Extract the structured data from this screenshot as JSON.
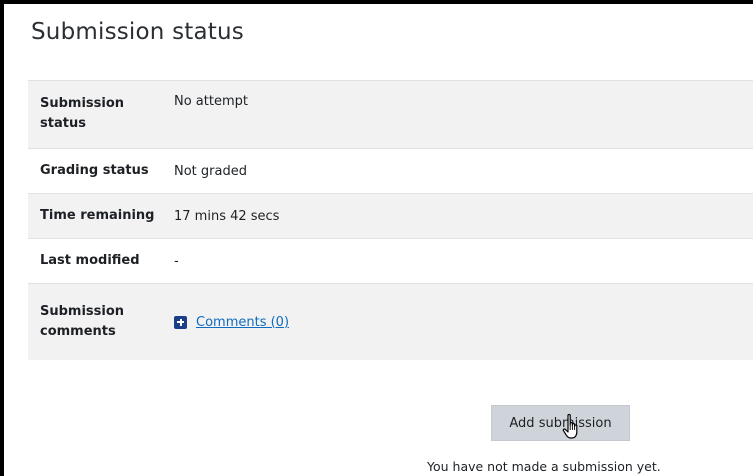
{
  "page": {
    "title": "Submission status"
  },
  "status_rows": [
    {
      "label": "Submission status",
      "value": "No attempt"
    },
    {
      "label": "Grading status",
      "value": "Not graded"
    },
    {
      "label": "Time remaining",
      "value": "17 mins 42 secs"
    },
    {
      "label": "Last modified",
      "value": "-"
    },
    {
      "label": "Submission comments",
      "value": "Comments (0)"
    }
  ],
  "actions": {
    "add_submission_label": "Add submission",
    "notice": "You have not made a submission yet."
  },
  "icons": {
    "comments_expand": "plus-square-icon",
    "cursor": "hand-pointer-icon"
  },
  "colors": {
    "link": "#0f6cbf",
    "row_shade": "#f2f2f2",
    "button_bg": "#ced4da",
    "plus_icon": "#1a3f8a"
  }
}
